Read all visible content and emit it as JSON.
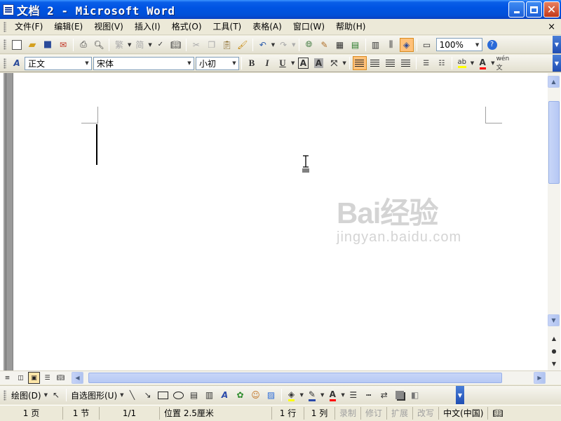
{
  "window": {
    "title": "文档 2 - Microsoft Word"
  },
  "menu": {
    "items": [
      "文件(F)",
      "编辑(E)",
      "视图(V)",
      "插入(I)",
      "格式(O)",
      "工具(T)",
      "表格(A)",
      "窗口(W)",
      "帮助(H)"
    ],
    "close": "×"
  },
  "toolbar_standard": {
    "zoom": "100%"
  },
  "toolbar_format": {
    "style": "正文",
    "font": "宋体",
    "size": "小初"
  },
  "document": {
    "watermark_main": "Bai经验",
    "watermark_sub": "jingyan.baidu.com"
  },
  "drawing_toolbar": {
    "draw_label": "绘图(D)",
    "autoshapes_label": "自选图形(U)"
  },
  "status": {
    "page": "1 页",
    "section": "1 节",
    "page_of": "1/1",
    "position": "位置 2.5厘米",
    "line": "1 行",
    "column": "1 列",
    "rec": "录制",
    "trk": "修订",
    "ext": "扩展",
    "ovr": "改写",
    "language": "中文(中国)"
  },
  "colors": {
    "titlebar": "#0054e3",
    "highlight": "#ffc17a",
    "font_color_bar": "#ff0000",
    "highlight_color_bar": "#ffff00"
  }
}
